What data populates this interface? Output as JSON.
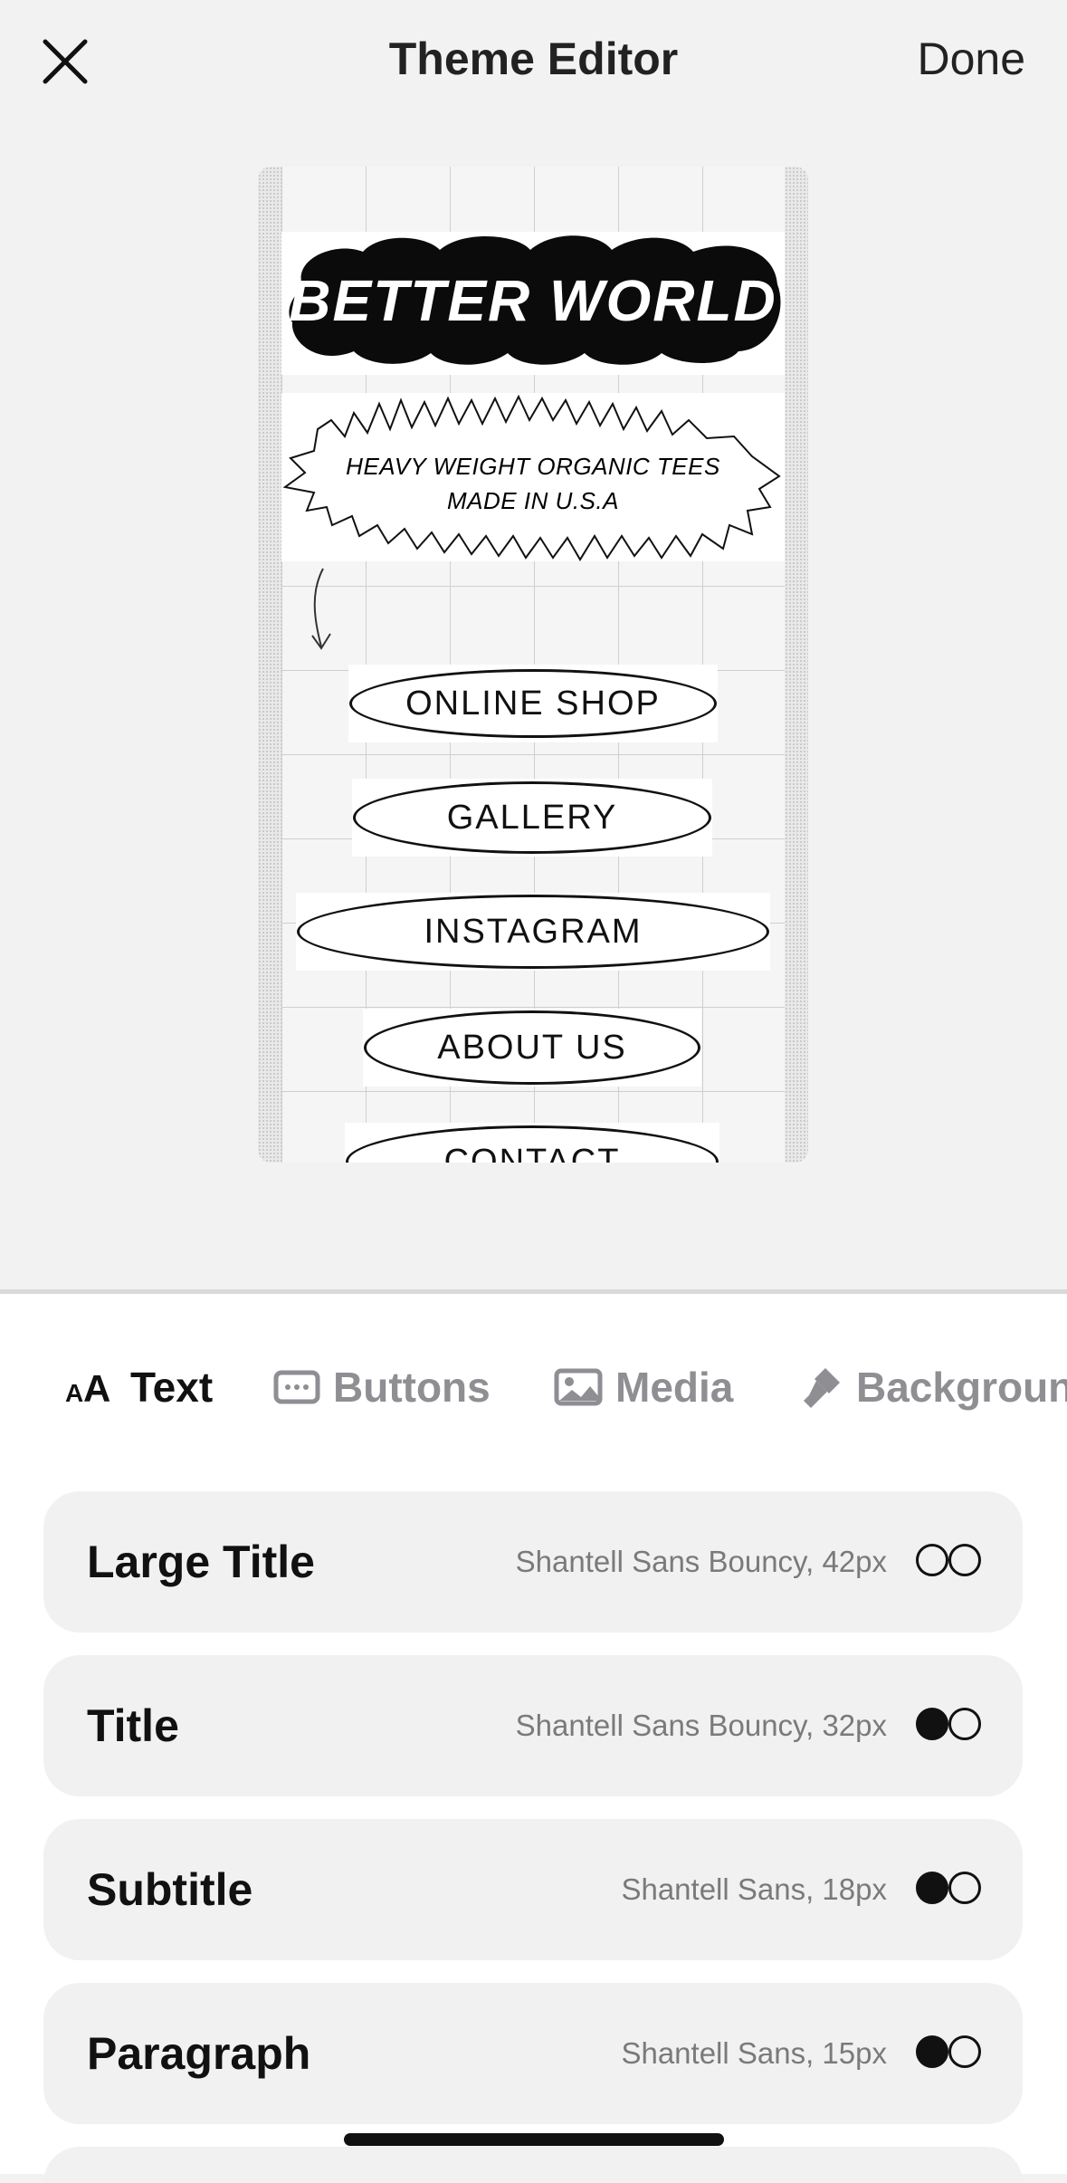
{
  "header": {
    "title": "Theme Editor",
    "done_label": "Done"
  },
  "preview": {
    "logo_text": "BETTER WORLD",
    "tagline_line1": "HEAVY WEIGHT ORGANIC TEES",
    "tagline_line2": "MADE IN U.S.A",
    "buttons": [
      "ONLINE SHOP",
      "GALLERY",
      "INSTAGRAM",
      "ABOUT US",
      "CONTACT"
    ]
  },
  "tabs": [
    {
      "label": "Text",
      "icon": "text-size-icon",
      "active": true
    },
    {
      "label": "Buttons",
      "icon": "button-icon",
      "active": false
    },
    {
      "label": "Media",
      "icon": "image-icon",
      "active": false
    },
    {
      "label": "Backgroun",
      "icon": "paint-icon",
      "active": false
    }
  ],
  "text_styles": [
    {
      "name": "Large Title",
      "spec": "Shantell Sans Bouncy, 42px",
      "color_filled": false
    },
    {
      "name": "Title",
      "spec": "Shantell Sans Bouncy, 32px",
      "color_filled": true
    },
    {
      "name": "Subtitle",
      "spec": "Shantell Sans, 18px",
      "color_filled": true
    },
    {
      "name": "Paragraph",
      "spec": "Shantell Sans, 15px",
      "color_filled": true
    }
  ]
}
